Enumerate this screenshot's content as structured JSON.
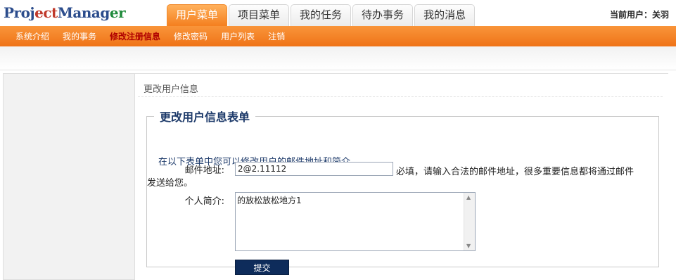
{
  "app": {
    "logo_parts": [
      "Proj",
      "ect",
      "Manag",
      "er"
    ]
  },
  "header": {
    "tabs": [
      "用户菜单",
      "项目菜单",
      "我的任务",
      "待办事务",
      "我的消息"
    ],
    "current_user": "当前用户：关羽"
  },
  "subnav": {
    "items": [
      "系统介绍",
      "我的事务",
      "修改注册信息",
      "修改密码",
      "用户列表",
      "注销"
    ]
  },
  "breadcrumb": "更改用户信息",
  "form": {
    "title": "更改用户信息表单",
    "intro": "在以下表单中您可以修改用户的邮件地址和简介.",
    "email_label": "邮件地址:",
    "email_value": "2@2.11112",
    "email_hint_line1": "必填，请输入合法的邮件地址，很多重要信息都将通过邮件",
    "email_hint_line2": "发送给您。",
    "bio_label": "个人简介:",
    "bio_value": "的放松放松地方1",
    "submit_label": "提交"
  },
  "colors": {
    "accent_orange": "#f47f1f",
    "nav_active": "#b00000",
    "title_blue": "#1d3a6a",
    "submit_bg": "#0e2c5b"
  }
}
